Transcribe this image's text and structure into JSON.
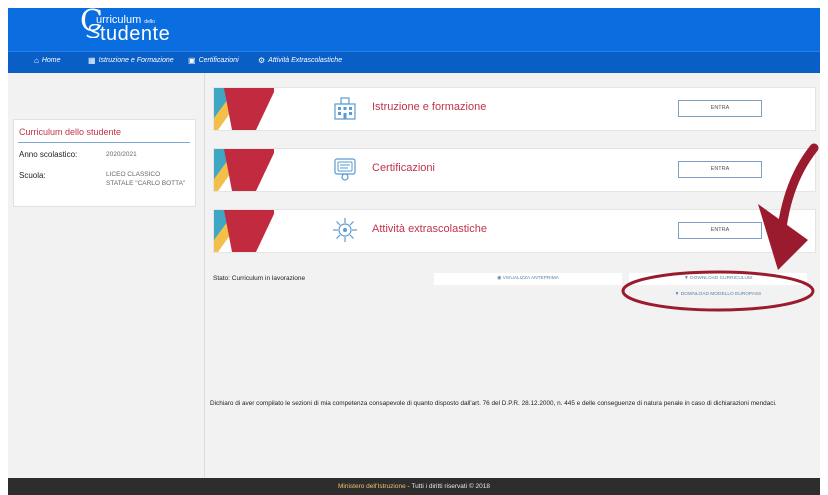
{
  "header": {
    "logo_line1": "urriculum",
    "logo_small": "dello",
    "logo_line2": "tudente",
    "logo_c": "C"
  },
  "nav": {
    "items": [
      {
        "label": "Home",
        "icon": "home-icon"
      },
      {
        "label": "Istruzione e Formazione",
        "icon": "building-icon"
      },
      {
        "label": "Certificazioni",
        "icon": "certificate-icon"
      },
      {
        "label": "Attività Extrascolastiche",
        "icon": "gear-icon"
      }
    ]
  },
  "sidebar": {
    "title": "Curriculum dello studente",
    "rows": [
      {
        "label": "Anno scolastico:",
        "value": "2020/2021"
      },
      {
        "label": "Scuola:",
        "value": "LICEO CLASSICO STATALE \"CARLO BOTTA\""
      }
    ]
  },
  "sections": [
    {
      "title": "Istruzione e formazione",
      "button": "ENTRA",
      "icon": "school-building-icon"
    },
    {
      "title": "Certificazioni",
      "button": "ENTRA",
      "icon": "certificate-icon"
    },
    {
      "title": "Attività extrascolastiche",
      "button": "ENTRA",
      "icon": "virus-gear-icon"
    }
  ],
  "status": {
    "text": "Stato: Curriculum in lavorazione"
  },
  "actions": {
    "preview": "VISUALIZZA ANTEPRIMA",
    "download_curriculum": "DOWNLOAD CURRICULUM",
    "download_europass": "DOWNLOAD MODELLO EUROPASS"
  },
  "declaration": "Dichiaro di aver compilato le sezioni di mia competenza consapevole di quanto disposto dall'art. 76 del D.P.R. 28.12.2000, n. 445 e delle conseguenze di natura penale in caso di dichiarazioni mendaci.",
  "footer": {
    "link": "Ministero dell'Istruzione",
    "text": " - Tutti i diritti riservati © 2018"
  },
  "colors": {
    "header_blue": "#0a6de0",
    "nav_blue": "#0a5fc7",
    "accent_red": "#c0334a",
    "annotation": "#9b1b2e"
  }
}
